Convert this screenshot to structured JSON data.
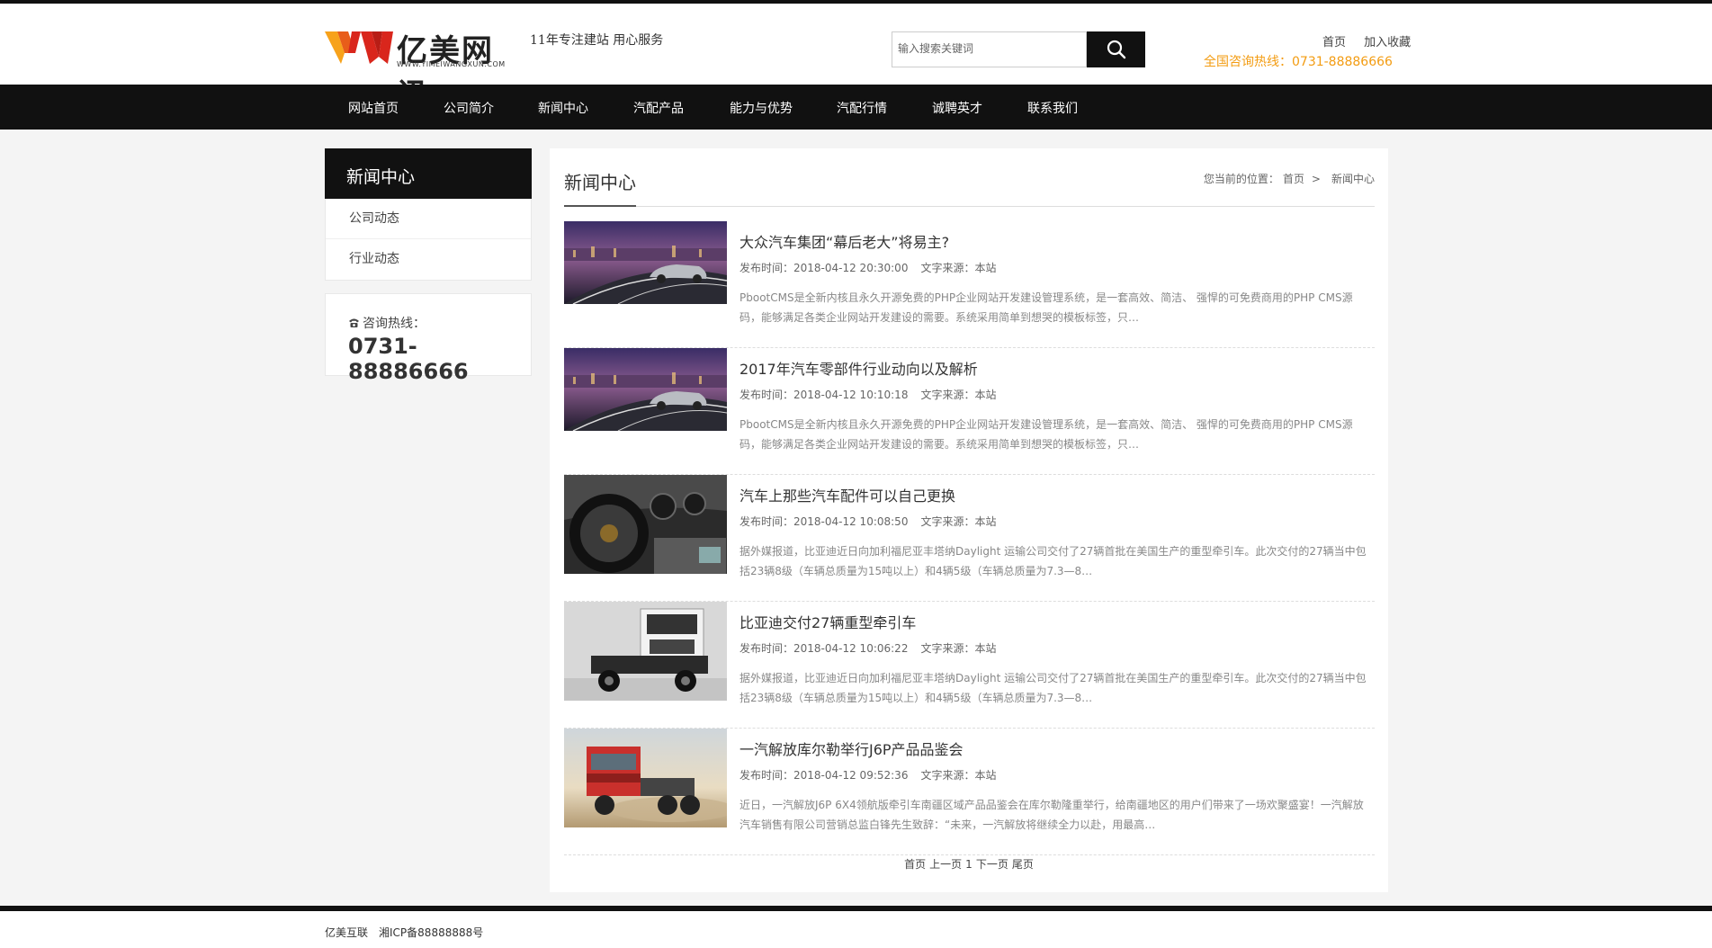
{
  "header": {
    "logo_cn": "亿美网讯",
    "logo_en": "WWW.YIMEIWANGXUN.COM",
    "slogan": "11年专注建站 用心服务",
    "search_placeholder": "输入搜索关键词",
    "top_links": [
      "首页",
      "加入收藏"
    ],
    "hotline": "全国咨询热线：0731-88886666"
  },
  "nav": {
    "items": [
      "网站首页",
      "公司简介",
      "新闻中心",
      "汽配产品",
      "能力与优势",
      "汽配行情",
      "诚聘英才",
      "联系我们"
    ]
  },
  "sidebar": {
    "title": "新闻中心",
    "items": [
      "公司动态",
      "行业动态"
    ],
    "contact_label": "咨询热线：",
    "contact_number": "0731-88886666"
  },
  "main": {
    "title": "新闻中心",
    "breadcrumb": {
      "prefix": "您当前的位置：",
      "home": "首页",
      "sep": ">",
      "current": "新闻中心"
    },
    "news": [
      {
        "title": "大众汽车集团“幕后老大”将易主?",
        "date": "发布时间：2018-04-12 20:30:00",
        "source": "文字来源：本站",
        "desc": "PbootCMS是全新内核且永久开源免费的PHP企业网站开发建设管理系统，是一套高效、简洁、 强悍的可免费商用的PHP CMS源码，能够满足各类企业网站开发建设的需要。系统采用简单到想哭的模板标签，只…"
      },
      {
        "title": "2017年汽车零部件行业动向以及解析",
        "date": "发布时间：2018-04-12 10:10:18",
        "source": "文字来源：本站",
        "desc": "PbootCMS是全新内核且永久开源免费的PHP企业网站开发建设管理系统，是一套高效、简洁、 强悍的可免费商用的PHP CMS源码，能够满足各类企业网站开发建设的需要。系统采用简单到想哭的模板标签，只…"
      },
      {
        "title": "汽车上那些汽车配件可以自己更换",
        "date": "发布时间：2018-04-12 10:08:50",
        "source": "文字来源：本站",
        "desc": "据外媒报道，比亚迪近日向加利福尼亚丰塔纳Daylight 运输公司交付了27辆首批在美国生产的重型牵引车。此次交付的27辆当中包括23辆8级（车辆总质量为15吨以上）和4辆5级（车辆总质量为7.3—8…"
      },
      {
        "title": "比亚迪交付27辆重型牵引车",
        "date": "发布时间：2018-04-12 10:06:22",
        "source": "文字来源：本站",
        "desc": "据外媒报道，比亚迪近日向加利福尼亚丰塔纳Daylight 运输公司交付了27辆首批在美国生产的重型牵引车。此次交付的27辆当中包括23辆8级（车辆总质量为15吨以上）和4辆5级（车辆总质量为7.3—8…"
      },
      {
        "title": "一汽解放库尔勒举行J6P产品品鉴会",
        "date": "发布时间：2018-04-12 09:52:36",
        "source": "文字来源：本站",
        "desc": "近日，一汽解放J6P 6X4领航版牵引车南疆区域产品品鉴会在库尔勒隆重举行，给南疆地区的用户们带来了一场欢聚盛宴！一汽解放汽车销售有限公司营销总监白锋先生致辞：“未来，一汽解放将继续全力以赴，用最高…"
      }
    ],
    "pager": [
      "首页",
      "上一页",
      "1",
      "下一页",
      "尾页"
    ]
  },
  "footer": {
    "company": "亿美互联",
    "icp": "湘ICP备88888888号"
  },
  "colors": {
    "dark": "#111111",
    "accent": "#f39c12",
    "logo_orange": "#f7a21b",
    "logo_red": "#d9261c"
  }
}
